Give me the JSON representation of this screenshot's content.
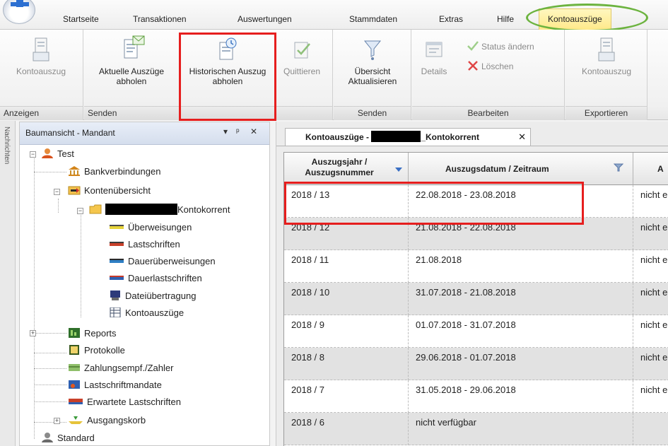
{
  "menu": {
    "tabs": [
      "Startseite",
      "Transaktionen",
      "Auswertungen",
      "Stammdaten",
      "Extras",
      "Hilfe",
      "Kontoauszüge"
    ],
    "active_tab": "Kontoauszüge"
  },
  "ribbon": {
    "groups": {
      "anzeigen": {
        "label": "Anzeigen",
        "buttons": {
          "kontoauszug": "Kontoauszug"
        }
      },
      "senden1": {
        "label": "Senden",
        "buttons": {
          "aktuelle": "Aktuelle Auszüge abholen",
          "historischen": "Historischen Auszug abholen",
          "quittieren": "Quittieren"
        }
      },
      "senden2": {
        "label": "Senden",
        "buttons": {
          "uebersicht": "Übersicht Aktualisieren"
        }
      },
      "bearbeiten": {
        "label": "Bearbeiten",
        "buttons": {
          "details": "Details",
          "status": "Status ändern",
          "loeschen": "Löschen"
        }
      },
      "exportieren": {
        "label": "Exportieren",
        "buttons": {
          "kontoauszug": "Kontoauszug"
        }
      }
    }
  },
  "side_strip": {
    "label": "Nachrichten"
  },
  "tree": {
    "title": "Baumansicht - Mandant",
    "controls": {
      "dropdown": "▾",
      "pin": "ᵖ",
      "close": "✕"
    },
    "nodes": {
      "test": "Test",
      "bankverbindungen": "Bankverbindungen",
      "kontenuebersicht": "Kontenübersicht",
      "kontokorrent": "Kontokorrent",
      "ueberweisungen": "Überweisungen",
      "lastschriften": "Lastschriften",
      "dauerueberweisungen": "Dauerüberweisungen",
      "dauerlastschriften": "Dauerlastschriften",
      "dateiuebertragung": "Dateiübertragung",
      "kontoauszuege": "Kontoauszüge",
      "reports": "Reports",
      "protokolle": "Protokolle",
      "zahlungsempf": "Zahlungsempf./Zahler",
      "lastschriftmandate": "Lastschriftmandate",
      "erwartete": "Erwartete Lastschriften",
      "ausgangskorb": "Ausgangskorb",
      "standard": "Standard"
    }
  },
  "document": {
    "tab": {
      "prefix": "Kontoauszüge - ",
      "suffix": "_Kontokorrent",
      "close": "✕"
    },
    "grid": {
      "columns": [
        "Auszugsjahr / Auszugsnummer",
        "Auszugsdatum / Zeitraum",
        "A"
      ],
      "rows": [
        [
          "2018 / 13",
          "22.08.2018 - 23.08.2018",
          "nicht er"
        ],
        [
          "2018 / 12",
          "21.08.2018 - 22.08.2018",
          "nicht er"
        ],
        [
          "2018 / 11",
          "21.08.2018",
          "nicht er"
        ],
        [
          "2018 / 10",
          "31.07.2018 - 21.08.2018",
          "nicht er"
        ],
        [
          "2018 / 9",
          "01.07.2018 - 31.07.2018",
          "nicht er"
        ],
        [
          "2018 / 8",
          "29.06.2018 - 01.07.2018",
          "nicht er"
        ],
        [
          "2018 / 7",
          "31.05.2018 - 29.06.2018",
          "nicht er"
        ],
        [
          "2018 / 6",
          "nicht verfügbar",
          ""
        ]
      ]
    }
  },
  "colors": {
    "highlight_red": "#e61e1e",
    "highlight_green": "#6cb33f",
    "active_tab_yellow": "#ffe98a",
    "row_alt": "#e2e2e2"
  }
}
